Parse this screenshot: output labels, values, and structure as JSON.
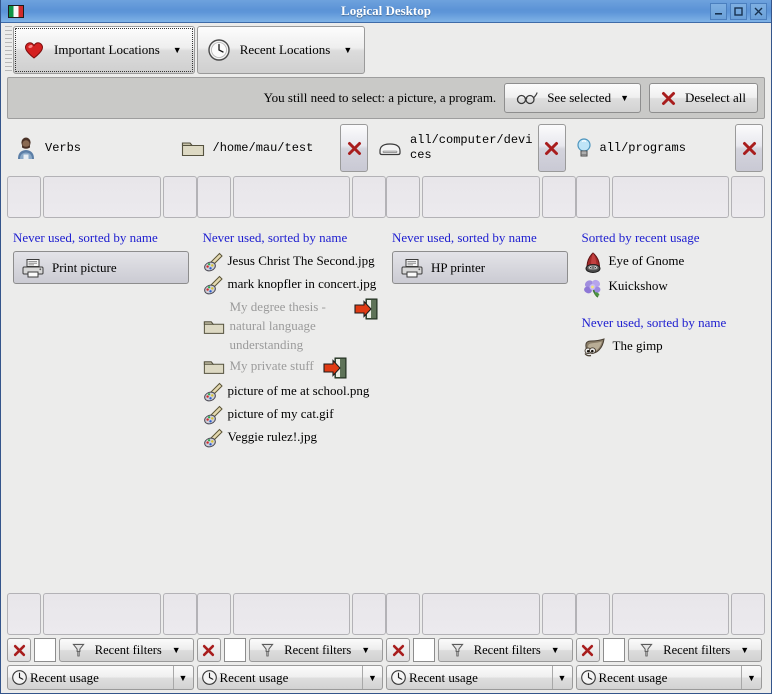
{
  "window": {
    "title": "Logical Desktop",
    "app_icon": "italian-flag-icon",
    "minimize_label": "_",
    "maximize_label": "□",
    "close_label": "×"
  },
  "toolbar": {
    "tabs": [
      {
        "label": "Important Locations",
        "icon": "heart-icon",
        "caret": "▼",
        "active": true
      },
      {
        "label": "Recent Locations",
        "icon": "clock-icon",
        "caret": "▼",
        "active": false
      }
    ]
  },
  "statusbar": {
    "message": "You still need to select: a picture, a program.",
    "see_selected_label": "See selected",
    "see_selected_icon": "glasses-icon",
    "see_selected_caret": "▼",
    "deselect_all_label": "Deselect all",
    "deselect_all_icon": "red-x-icon"
  },
  "locations": [
    {
      "label": "Verbs",
      "icon": "person-icon",
      "has_close": false
    },
    {
      "label": "/home/mau/test",
      "icon": "folder-icon",
      "has_close": true
    },
    {
      "label": "all/computer/devices",
      "icon": "drive-icon",
      "has_close": true
    },
    {
      "label": "all/programs",
      "icon": "lightbulb-icon",
      "has_close": true
    }
  ],
  "close_icon_label": "×",
  "columns": [
    {
      "sections": [
        {
          "heading": "Never used, sorted by name",
          "items": [
            {
              "label": "Print picture",
              "icon": "printer-icon",
              "style": "boxed",
              "go": false
            }
          ]
        }
      ]
    },
    {
      "sections": [
        {
          "heading": "Never used, sorted by name",
          "items": [
            {
              "label": "Jesus Christ The Second.jpg",
              "icon": "palette-icon",
              "style": "plain",
              "go": false
            },
            {
              "label": "mark knopfler in concert.jpg",
              "icon": "palette-icon",
              "style": "plain",
              "go": false
            },
            {
              "label": "My degree thesis - natural language understanding",
              "icon": "folder-icon",
              "style": "dim",
              "go": true
            },
            {
              "label": "My private stuff",
              "icon": "folder-icon",
              "style": "dim",
              "go": true
            },
            {
              "label": "picture of me at school.png",
              "icon": "palette-icon",
              "style": "plain",
              "go": false
            },
            {
              "label": "picture of my cat.gif",
              "icon": "palette-icon",
              "style": "plain",
              "go": false
            },
            {
              "label": "Veggie rulez!.jpg",
              "icon": "palette-icon",
              "style": "plain",
              "go": false
            }
          ]
        }
      ]
    },
    {
      "sections": [
        {
          "heading": "Never used, sorted by name",
          "items": [
            {
              "label": "HP printer",
              "icon": "printer-icon",
              "style": "boxed",
              "go": false
            }
          ]
        }
      ]
    },
    {
      "sections": [
        {
          "heading": "Sorted by recent usage",
          "items": [
            {
              "label": "Eye of Gnome",
              "icon": "gnome-hat-icon",
              "style": "plain",
              "go": false
            },
            {
              "label": "Kuickshow",
              "icon": "flower-icon",
              "style": "plain",
              "go": false
            }
          ]
        },
        {
          "heading": "Never used, sorted by name",
          "items": [
            {
              "label": "The gimp",
              "icon": "gimp-icon",
              "style": "plain",
              "go": false
            }
          ]
        }
      ]
    }
  ],
  "filters": {
    "clear_icon": "red-x-icon",
    "text_value": "",
    "recent_filters_label": "Recent filters",
    "recent_filters_icon": "funnel-icon",
    "caret": "▼",
    "recent_usage_label": "Recent usage",
    "recent_usage_icon": "clock-icon"
  },
  "colors": {
    "titlebar_blue": "#5b93d6",
    "heading_blue": "#2020d0",
    "panel_gray": "#ececeb",
    "statusbar_gray": "#c9c9c7",
    "dim_text": "#9b9b9b",
    "close_red": "#a81d1d"
  }
}
